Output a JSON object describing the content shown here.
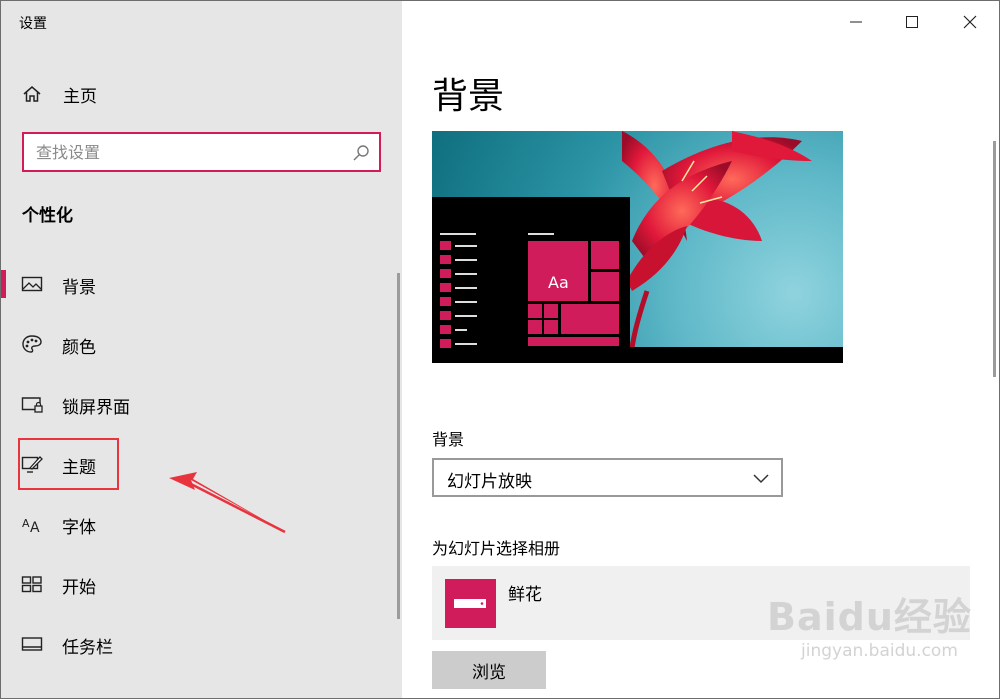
{
  "window": {
    "title": "设置"
  },
  "sidebar": {
    "home_label": "主页",
    "search_placeholder": "查找设置",
    "section_title": "个性化",
    "items": [
      {
        "label": "背景",
        "icon": "picture-icon",
        "active": true
      },
      {
        "label": "颜色",
        "icon": "palette-icon",
        "active": false
      },
      {
        "label": "锁屏界面",
        "icon": "lock-screen-icon",
        "active": false
      },
      {
        "label": "主题",
        "icon": "theme-brush-icon",
        "active": false
      },
      {
        "label": "字体",
        "icon": "font-icon",
        "active": false
      },
      {
        "label": "开始",
        "icon": "start-grid-icon",
        "active": false
      },
      {
        "label": "任务栏",
        "icon": "taskbar-icon",
        "active": false
      }
    ]
  },
  "main": {
    "page_title": "背景",
    "preview": {
      "tile_label": "Aa"
    },
    "background_label": "背景",
    "background_value": "幻灯片放映",
    "album_label": "为幻灯片选择相册",
    "album_name": "鲜花",
    "browse_label": "浏览"
  },
  "watermark": {
    "line1": "Baidu经验",
    "line2": "jingyan.baidu.com"
  },
  "colors": {
    "accent": "#d01c5b",
    "annotation": "#e8343f",
    "sidebar_bg": "#e6e6e6"
  }
}
